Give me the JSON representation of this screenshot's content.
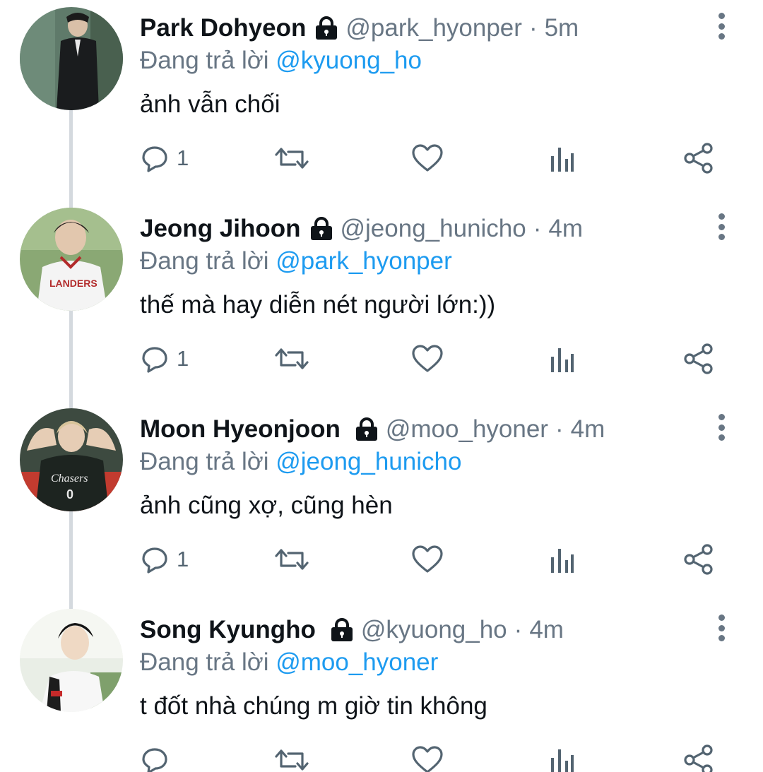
{
  "reply_prefix": "Đang trả lời",
  "colors": {
    "text": "#0f1419",
    "secondary": "#687684",
    "mention": "#1d9bf0",
    "thread_line": "#d4d9de"
  },
  "tweets": [
    {
      "name": "Park Dohyeon",
      "handle": "@park_hyonper",
      "time": "5m",
      "reply_to": "@kyuong_ho",
      "text": "ảnh vẫn chối",
      "reply_count": "1",
      "avatar": "person-in-suit"
    },
    {
      "name": "Jeong Jihoon",
      "handle": "@jeong_hunicho",
      "time": "4m",
      "reply_to": "@park_hyonper",
      "text": "thế mà hay diễn nét người lớn:))",
      "reply_count": "1",
      "avatar": "person-in-baseball-jersey"
    },
    {
      "name": "Moon Hyeonjoon",
      "handle": "@moo_hyoner",
      "time": "4m",
      "reply_to": "@jeong_hunicho",
      "text": "ảnh cũng xợ, cũng hèn",
      "reply_count": "1",
      "avatar": "person-in-team-jacket"
    },
    {
      "name": "Song Kyungho",
      "handle": "@kyuong_ho",
      "time": "4m",
      "reply_to": "@moo_hyoner",
      "text": "t đốt nhà chúng m giờ tin không",
      "reply_count": "",
      "avatar": "person-in-white-jersey"
    }
  ],
  "separator": "·",
  "icons": [
    "lock-icon",
    "reply-icon",
    "retweet-icon",
    "like-icon",
    "analytics-icon",
    "share-icon",
    "more-options-icon"
  ]
}
